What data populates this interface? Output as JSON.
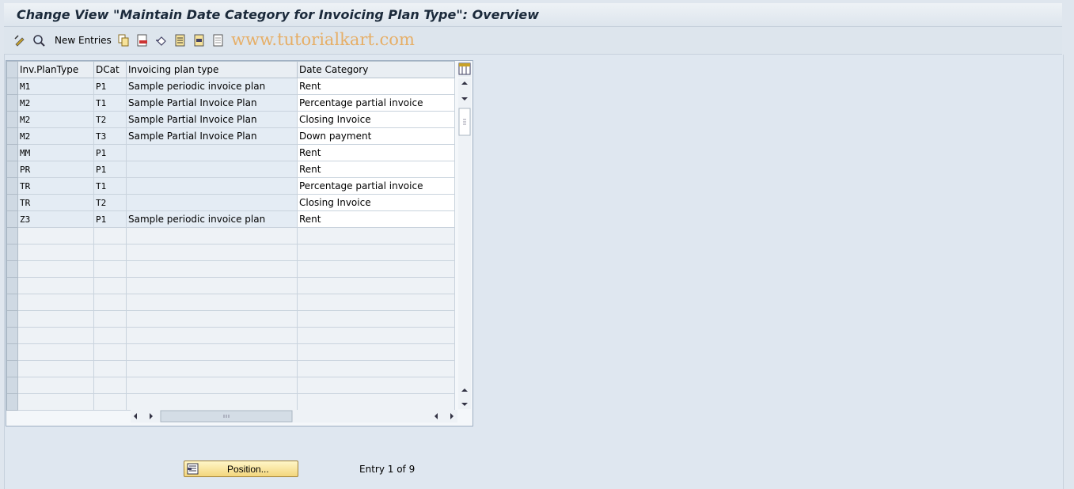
{
  "title": "Change View \"Maintain Date Category for Invoicing Plan Type\": Overview",
  "toolbar": {
    "new_entries": "New Entries",
    "watermark": "www.tutorialkart.com",
    "icons": [
      "change-display-icon",
      "details-icon",
      "copy-icon",
      "delete-icon",
      "undo-icon",
      "select-all-icon",
      "select-block-icon",
      "deselect-all-icon"
    ]
  },
  "table": {
    "columns": [
      "Inv.PlanType",
      "DCat",
      "Invoicing plan type",
      "Date Category"
    ],
    "rows": [
      [
        "M1",
        "P1",
        "Sample periodic invoice plan",
        "Rent"
      ],
      [
        "M2",
        "T1",
        "Sample Partial Invoice Plan",
        "Percentage partial invoice"
      ],
      [
        "M2",
        "T2",
        "Sample Partial Invoice Plan",
        "Closing Invoice"
      ],
      [
        "M2",
        "T3",
        "Sample Partial Invoice Plan",
        "Down payment"
      ],
      [
        "MM",
        "P1",
        "",
        "Rent"
      ],
      [
        "PR",
        "P1",
        "",
        "Rent"
      ],
      [
        "TR",
        "T1",
        "",
        "Percentage partial invoice"
      ],
      [
        "TR",
        "T2",
        "",
        "Closing Invoice"
      ],
      [
        "Z3",
        "P1",
        "Sample periodic invoice plan",
        "Rent"
      ]
    ],
    "empty_rows": 11
  },
  "footer": {
    "position_button": "Position...",
    "entry_text": "Entry 1 of 9"
  },
  "colors": {
    "header_bg": "#dde5ed",
    "key_cell_bg": "#e4ecf4",
    "button_bg": "#f3d67d"
  }
}
